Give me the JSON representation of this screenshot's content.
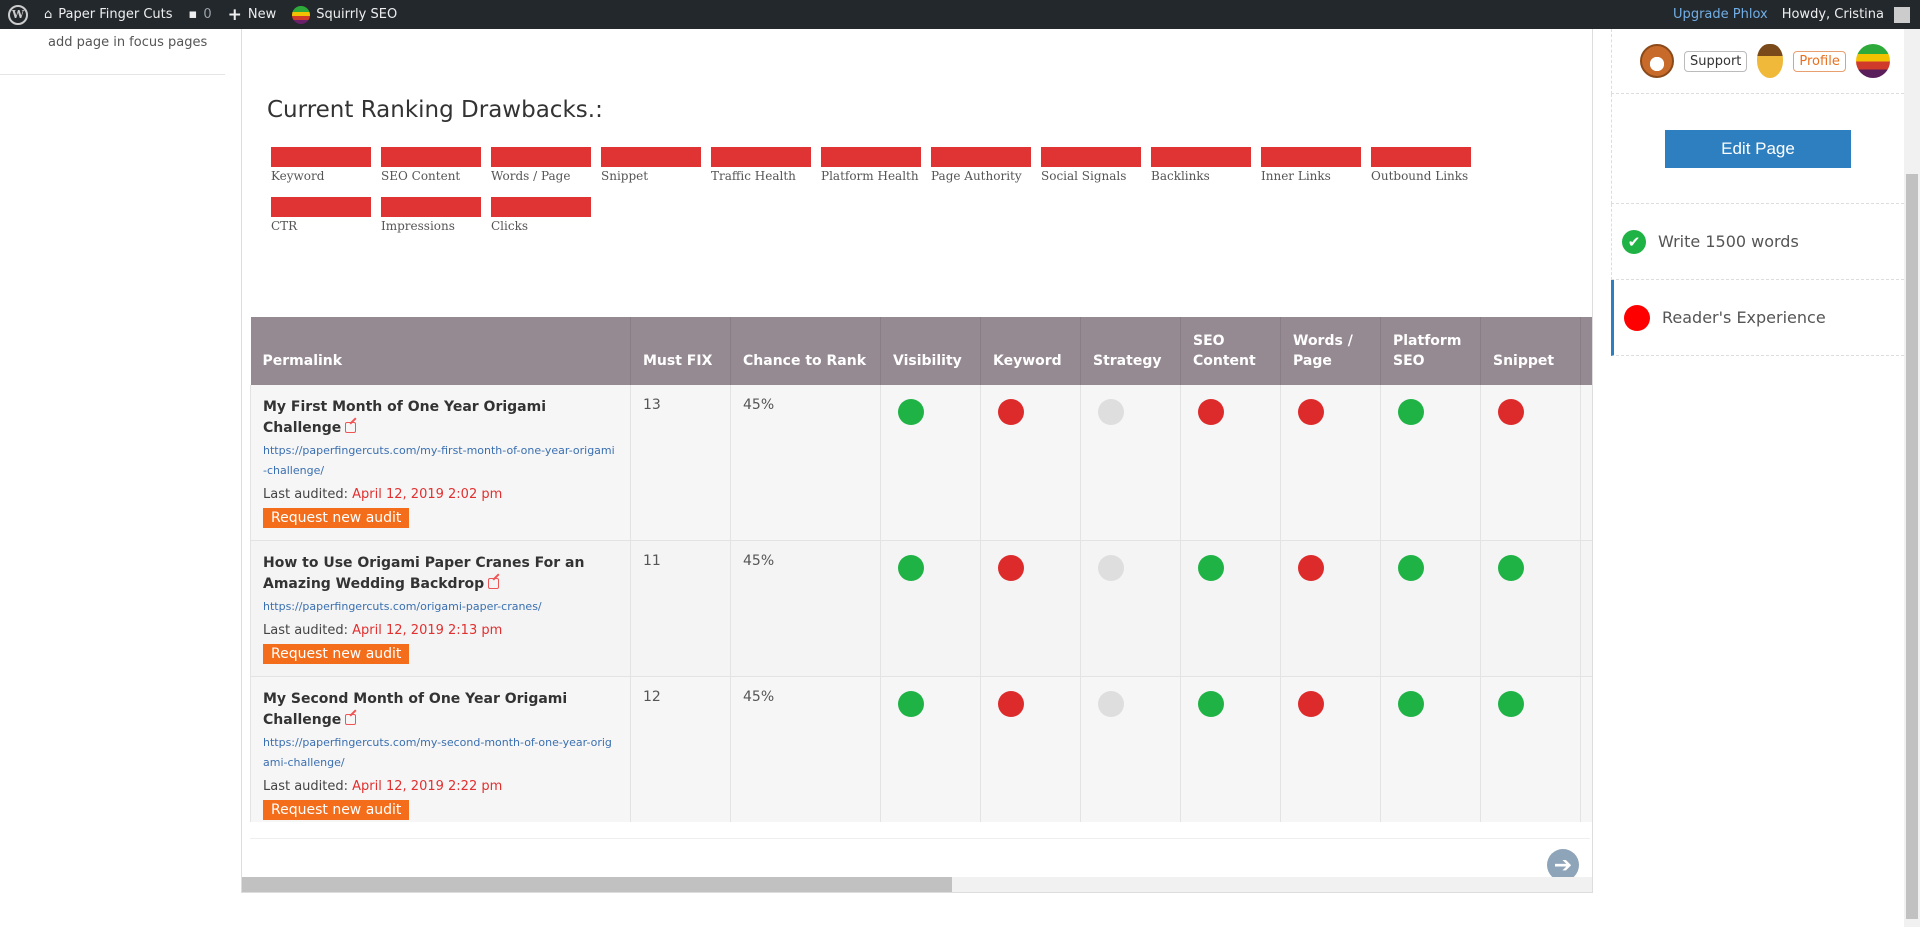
{
  "adminbar": {
    "site_name": "Paper Finger Cuts",
    "comments_count": "0",
    "new_label": "New",
    "plugin_name": "Squirrly SEO",
    "upgrade_label": "Upgrade Phlox",
    "howdy": "Howdy, Cristina"
  },
  "leftmenu": {
    "focus_link": "add page in focus pages"
  },
  "drawbacks": {
    "title": "Current Ranking Drawbacks.:",
    "items": [
      "Keyword",
      "SEO Content",
      "Words / Page",
      "Snippet",
      "Traffic Health",
      "Platform Health",
      "Page Authority",
      "Social Signals",
      "Backlinks",
      "Inner Links",
      "Outbound Links",
      "CTR",
      "Impressions",
      "Clicks"
    ],
    "bar_color": "#e03333"
  },
  "table": {
    "headers": [
      "Permalink",
      "Must FIX",
      "Chance to Rank",
      "Visibility",
      "Keyword",
      "Strategy",
      "SEO Content",
      "Words / Page",
      "Platform SEO",
      "Snippet"
    ],
    "last_audited_label": "Last audited:",
    "audit_button": "Request new audit",
    "rows": [
      {
        "title": "My First Month of One Year Origami Challenge",
        "url": "https://paperfingercuts.com/my-first-month-of-one-year-origami-challenge/",
        "audited": "April 12, 2019 2:02 pm",
        "must_fix": "13",
        "chance": "45%",
        "statuses": [
          "green",
          "red",
          "gray",
          "red",
          "red",
          "green",
          "red"
        ]
      },
      {
        "title": "How to Use Origami Paper Cranes For an Amazing Wedding Backdrop",
        "url": "https://paperfingercuts.com/origami-paper-cranes/",
        "audited": "April 12, 2019 2:13 pm",
        "must_fix": "11",
        "chance": "45%",
        "statuses": [
          "green",
          "red",
          "gray",
          "green",
          "red",
          "green",
          "green"
        ]
      },
      {
        "title": "My Second Month of One Year Origami Challenge",
        "url": "https://paperfingercuts.com/my-second-month-of-one-year-origami-challenge/",
        "audited": "April 12, 2019 2:22 pm",
        "must_fix": "12",
        "chance": "45%",
        "statuses": [
          "green",
          "red",
          "gray",
          "green",
          "red",
          "green",
          "green"
        ]
      }
    ]
  },
  "sidebar": {
    "support_label": "Support",
    "profile_label": "Profile",
    "edit_page_label": "Edit Page",
    "tasks": [
      {
        "label": "Write 1500 words",
        "status": "done"
      },
      {
        "label": "Reader's Experience",
        "status": "fail"
      }
    ]
  },
  "colors": {
    "header_bg": "#968a92",
    "accent_blue": "#2d7fbf",
    "audit_orange": "#f36d1a",
    "green": "#1fb346",
    "red": "#dd2b2b"
  }
}
